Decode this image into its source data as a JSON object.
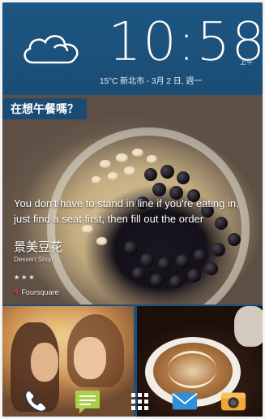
{
  "clock": {
    "time": "10:58",
    "ampm": "上午",
    "date": "15°C 新北市 - 3月 2 日, 週一",
    "weather_icon": "cloud-icon"
  },
  "feed": {
    "banner": "在想午餐嗎？",
    "quote": "You don't have to stand in line if you're eating in, just find a seat first, then fill out the order",
    "place_name": "景美豆花",
    "category": "Dessert Shop",
    "rating": "★★★",
    "source": "Foursquare"
  },
  "dock": {
    "icons": [
      "phone-icon",
      "messages-icon",
      "app-drawer-icon",
      "mail-icon",
      "camera-icon"
    ]
  },
  "colors": {
    "header_blue": "#1d5683",
    "banner_blue": "#1b4b73",
    "foursquare_pink": "#e0325c"
  }
}
